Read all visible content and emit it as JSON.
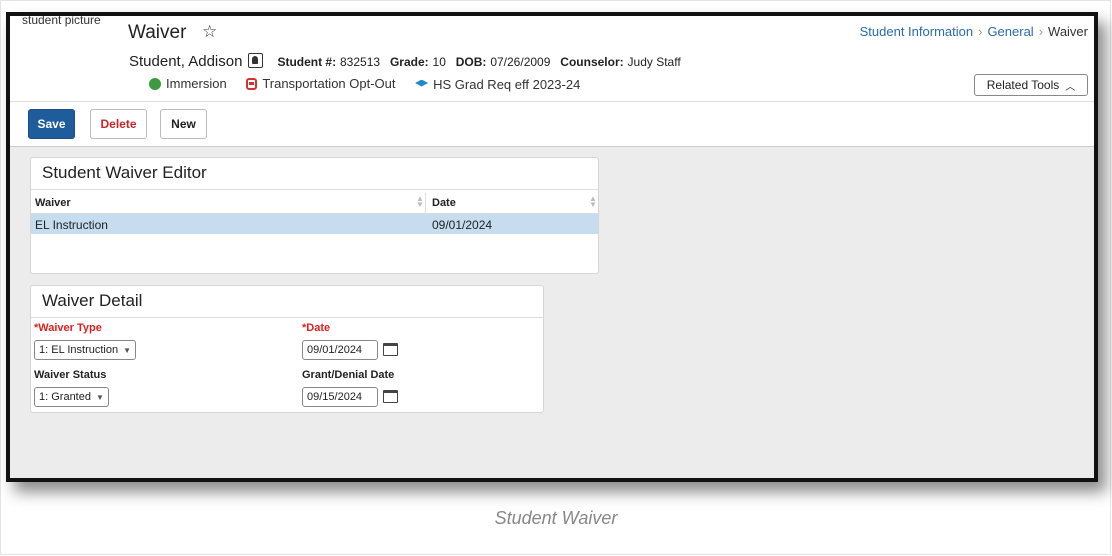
{
  "header": {
    "picture_alt": "student picture",
    "title": "Waiver",
    "star_icon": "star-outline-icon",
    "breadcrumb": [
      "Student Information",
      "General",
      "Waiver"
    ],
    "student": {
      "name": "Student, Addison",
      "number_label": "Student #:",
      "number": "832513",
      "grade_label": "Grade:",
      "grade": "10",
      "dob_label": "DOB:",
      "dob": "07/26/2009",
      "counselor_label": "Counselor:",
      "counselor": "Judy Staff"
    },
    "flags": [
      {
        "label": "Immersion",
        "icon": "globe-icon"
      },
      {
        "label": "Transportation Opt-Out",
        "icon": "bus-icon"
      },
      {
        "label": "HS Grad Req eff 2023-24",
        "icon": "graduation-cap-icon"
      }
    ],
    "related_tools": "Related Tools"
  },
  "toolbar": {
    "save": "Save",
    "delete": "Delete",
    "new": "New"
  },
  "editor": {
    "title": "Student Waiver Editor",
    "columns": [
      "Waiver",
      "Date"
    ],
    "rows": [
      {
        "waiver": "EL Instruction",
        "date": "09/01/2024"
      }
    ]
  },
  "detail": {
    "title": "Waiver Detail",
    "waiver_type_label": "*Waiver Type",
    "waiver_type_value": "1: EL Instruction",
    "date_label": "*Date",
    "date_value": "09/01/2024",
    "status_label": "Waiver Status",
    "status_value": "1: Granted",
    "grant_label": "Grant/Denial Date",
    "grant_value": "09/15/2024"
  },
  "caption": "Student Waiver",
  "colors": {
    "accent": "#1e5c9b",
    "link": "#2a6bb0",
    "required": "#e02020",
    "selected_row": "#c6dcef"
  }
}
